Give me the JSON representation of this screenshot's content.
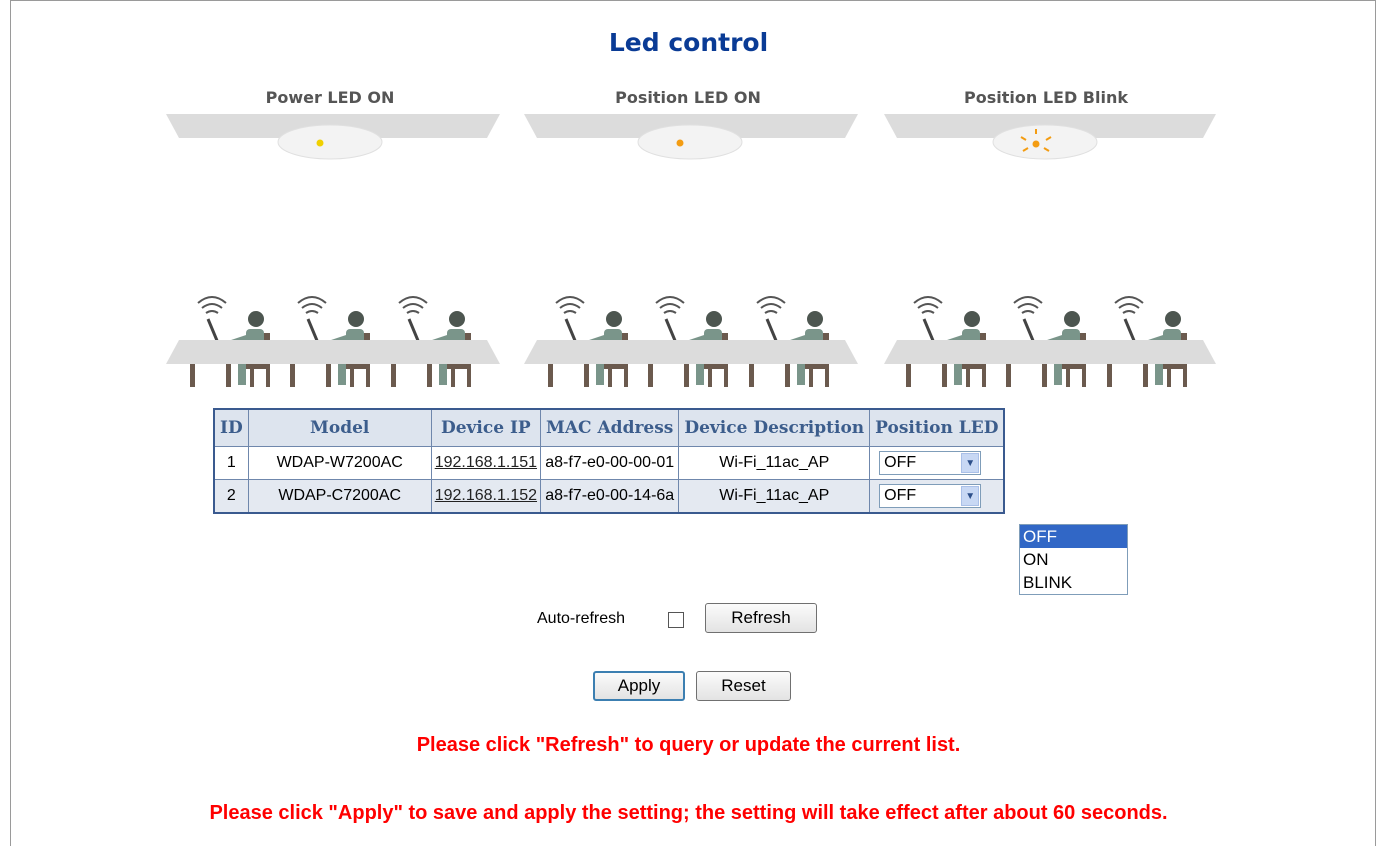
{
  "page": {
    "title": "Led control"
  },
  "illustration": {
    "groups": [
      {
        "label": "Power LED ON",
        "led": "yellow"
      },
      {
        "label": "Position LED ON",
        "led": "orange"
      },
      {
        "label": "Position LED Blink",
        "led": "blink"
      }
    ],
    "colors": {
      "plate": "#d9d9d9",
      "figure": "#6f7d74",
      "figure_dark": "#4d5650",
      "led_yellow": "#f0d000",
      "led_orange": "#f39c12"
    }
  },
  "table": {
    "headers": [
      "ID",
      "Model",
      "Device IP",
      "MAC Address",
      "Device Description",
      "Position LED"
    ],
    "rows": [
      {
        "id": "1",
        "model": "WDAP-W7200AC",
        "ip": "192.168.1.151",
        "mac": "a8-f7-e0-00-00-01",
        "desc": "Wi-Fi_11ac_AP",
        "led": "OFF"
      },
      {
        "id": "2",
        "model": "WDAP-C7200AC",
        "ip": "192.168.1.152",
        "mac": "a8-f7-e0-00-14-6a",
        "desc": "Wi-Fi_11ac_AP",
        "led": "OFF"
      }
    ]
  },
  "dropdown": {
    "options": [
      "OFF",
      "ON",
      "BLINK"
    ],
    "highlighted": "OFF"
  },
  "controls": {
    "auto_refresh_label": "Auto-refresh",
    "auto_refresh_checked": false,
    "refresh_label": "Refresh",
    "apply_label": "Apply",
    "reset_label": "Reset"
  },
  "messages": {
    "refresh_hint": "Please click \"Refresh\" to query or update the current list.",
    "apply_hint": "Please click \"Apply\" to save and apply the setting; the setting will take effect after about 60 seconds."
  }
}
